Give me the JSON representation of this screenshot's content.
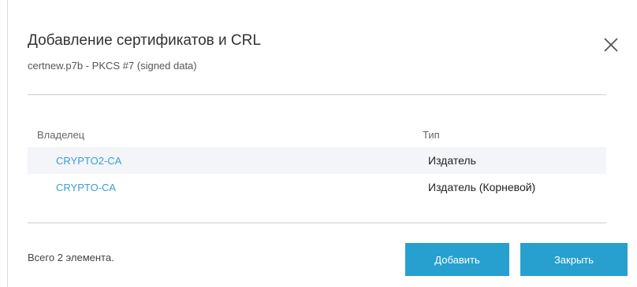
{
  "dialog": {
    "title": "Добавление сертификатов и CRL",
    "subtitle": "certnew.p7b - PKCS #7 (signed data)"
  },
  "table": {
    "columns": [
      "Владелец",
      "Тип"
    ],
    "rows": [
      {
        "owner": "CRYPTO2-CA",
        "type": "Издатель"
      },
      {
        "owner": "CRYPTO-CA",
        "type": "Издатель (Корневой)"
      }
    ]
  },
  "footer": {
    "count_text": "Всего 2 элемента.",
    "add_label": "Добавить",
    "close_label": "Закрыть"
  },
  "colors": {
    "accent": "#27a0cf",
    "link": "#3a9fd1",
    "row_stripe": "#f3f5f8"
  },
  "icons": {
    "close": "close-icon"
  }
}
